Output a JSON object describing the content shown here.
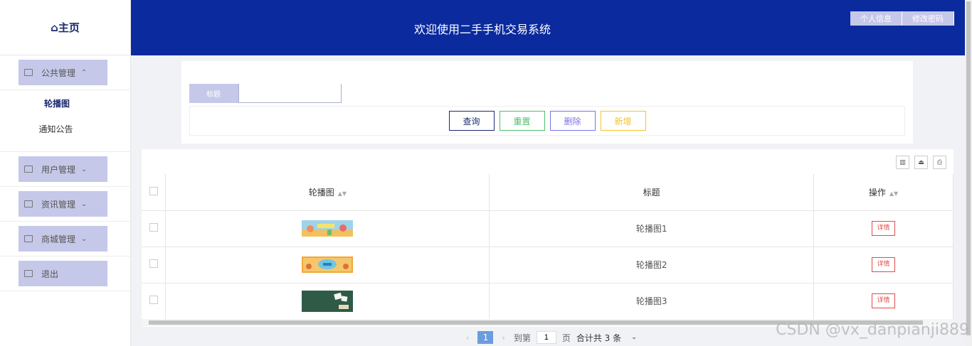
{
  "sidebar": {
    "logo": "⌂主页",
    "groups": [
      {
        "label": "公共管理",
        "chevron": "⌃"
      },
      {
        "label": "用户管理",
        "chevron": "⌄"
      },
      {
        "label": "资讯管理",
        "chevron": "⌄"
      },
      {
        "label": "商城管理",
        "chevron": "⌄"
      },
      {
        "label": "退出"
      }
    ],
    "sub_items": [
      "轮播图",
      "通知公告"
    ]
  },
  "header": {
    "title": "欢迎使用二手手机交易系统",
    "buttons": [
      "个人信息",
      "修改密码"
    ]
  },
  "search": {
    "label": "标题",
    "input_value": "",
    "buttons": [
      {
        "label": "查询",
        "color": "#1a2b6e"
      },
      {
        "label": "重置",
        "color": "#4cbf6b"
      },
      {
        "label": "删除",
        "color": "#7b74e8"
      },
      {
        "label": "新增",
        "color": "#f2c230"
      }
    ]
  },
  "table": {
    "headers": [
      "轮播图",
      "标题",
      "操作"
    ],
    "rows": [
      {
        "title": "轮播图1",
        "action": "详情"
      },
      {
        "title": "轮播图2",
        "action": "详情"
      },
      {
        "title": "轮播图3",
        "action": "详情"
      }
    ]
  },
  "pagination": {
    "prev": "‹",
    "current": "1",
    "next": "›",
    "goto_label": "到第",
    "goto_value": "1",
    "page_label": "页",
    "total": "合计共 3 条",
    "select_arrow": "⌄"
  },
  "watermark": "CSDN @vx_danpianji889"
}
